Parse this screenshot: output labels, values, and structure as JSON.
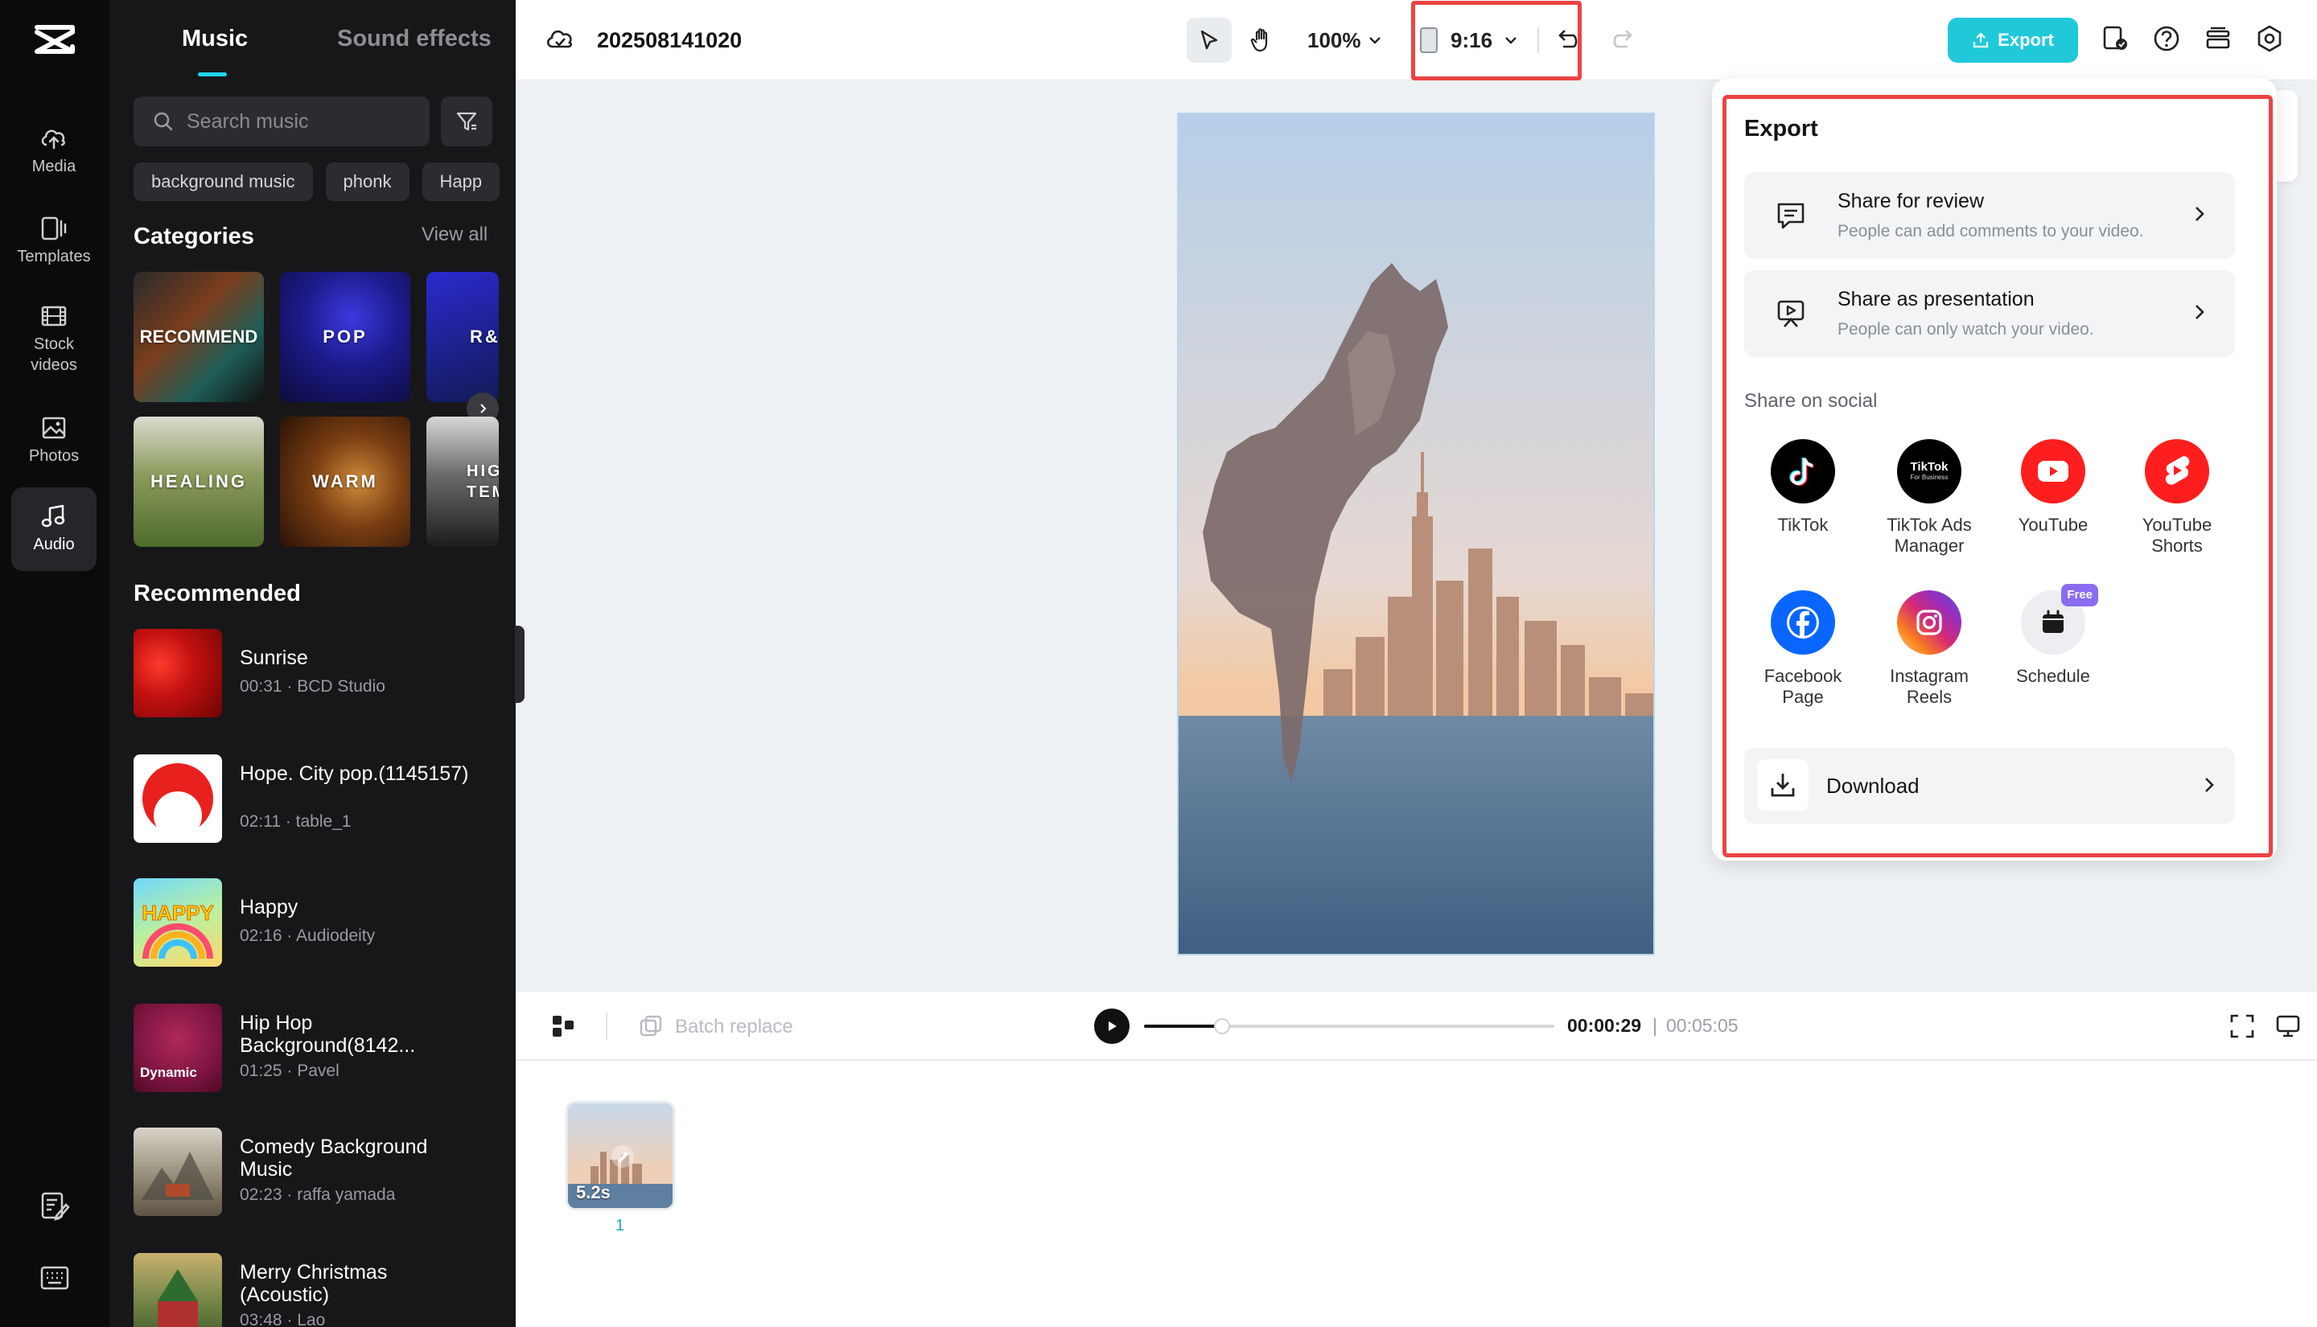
{
  "rail": {
    "items": [
      {
        "label": "Media",
        "icon": "cloud-upload-icon"
      },
      {
        "label": "Templates",
        "icon": "template-icon"
      },
      {
        "label": "Stock videos",
        "icon": "film-icon"
      },
      {
        "label": "Photos",
        "icon": "image-icon"
      },
      {
        "label": "Audio",
        "icon": "music-note-icon",
        "active": true
      }
    ]
  },
  "library": {
    "tabs": {
      "music": "Music",
      "sound_effects": "Sound effects"
    },
    "search_placeholder": "Search music",
    "chips": [
      "background music",
      "phonk",
      "Happ"
    ],
    "categories_title": "Categories",
    "view_all": "View all",
    "categories": [
      "RECOMMEND",
      "POP",
      "R&",
      "HEALING",
      "WARM",
      "HIG TEM"
    ],
    "recommended_title": "Recommended",
    "tracks": [
      {
        "name": "Sunrise",
        "meta": "00:31 · BCD Studio"
      },
      {
        "name": "Hope. City pop.(1145157)",
        "meta": "02:11 · table_1"
      },
      {
        "name": "Happy",
        "meta": "02:16 · Audiodeity"
      },
      {
        "name": "Hip Hop Background(8142...",
        "meta": "01:25 · Pavel",
        "thumb_label": "Dynamic"
      },
      {
        "name": "Comedy Background Music",
        "meta": "02:23 · raffa yamada"
      },
      {
        "name": "Merry Christmas (Acoustic)",
        "meta": "03:48 · Lao"
      }
    ]
  },
  "topbar": {
    "project_name": "202508141020",
    "zoom": "100%",
    "aspect_ratio": "9:16",
    "export_label": "Export"
  },
  "playback": {
    "batch_replace": "Batch replace",
    "current_time": "00:00:29",
    "divider": "|",
    "total_time": "00:05:05",
    "progress_fraction": 0.19
  },
  "timeline": {
    "clip_duration": "5.2s",
    "clip_index": "1"
  },
  "export_panel": {
    "title": "Export",
    "share_review": {
      "title": "Share for review",
      "subtitle": "People can add comments to your video."
    },
    "share_presentation": {
      "title": "Share as presentation",
      "subtitle": "People can only watch your video."
    },
    "social_title": "Share on social",
    "socials": [
      {
        "label": "TikTok"
      },
      {
        "label": "TikTok Ads Manager",
        "logo_text": "TikTok",
        "logo_sub": "For Business"
      },
      {
        "label": "YouTube"
      },
      {
        "label": "YouTube Shorts"
      },
      {
        "label": "Facebook Page"
      },
      {
        "label": "Instagram Reels"
      },
      {
        "label": "Schedule",
        "badge": "Free"
      }
    ],
    "download": "Download"
  },
  "colors": {
    "accent": "#20c9da",
    "highlight_red": "#ec4343",
    "panel_dark": "#17171a",
    "rail_dark": "#0b0b0c"
  }
}
